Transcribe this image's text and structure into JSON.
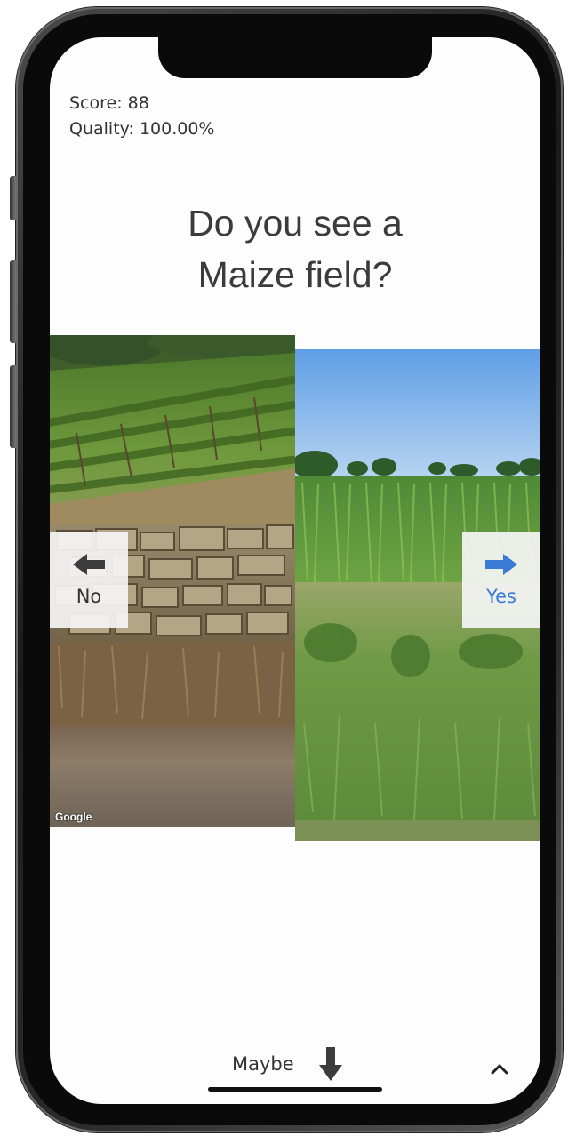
{
  "stats": {
    "score": "Score: 88",
    "quality": "Quality: 100.00%"
  },
  "question": {
    "line1": "Do you see a",
    "line2": "Maize field?"
  },
  "images": {
    "left": {
      "description_icon": "vineyard-photo",
      "attribution": "Google"
    },
    "right": {
      "description_icon": "maize-field-photo"
    }
  },
  "buttons": {
    "no": {
      "label": "No",
      "icon": "arrow-left-icon"
    },
    "yes": {
      "label": "Yes",
      "icon": "arrow-right-icon"
    },
    "maybe": {
      "label": "Maybe",
      "icon": "arrow-down-icon"
    },
    "expand": {
      "icon": "chevron-up-icon"
    }
  },
  "colors": {
    "yes_accent": "#3a7bd5",
    "text_primary": "#333333"
  }
}
